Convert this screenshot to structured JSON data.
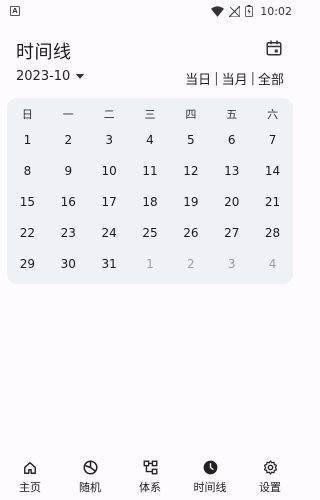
{
  "status_bar": {
    "notif_letter": "A",
    "time": "10:02"
  },
  "header": {
    "title": "时间线",
    "month": "2023-10",
    "filters": [
      "当日",
      "当月",
      "全部"
    ],
    "filter_separator": "|"
  },
  "calendar": {
    "weekdays": [
      "日",
      "一",
      "二",
      "三",
      "四",
      "五",
      "六"
    ],
    "weeks": [
      [
        {
          "d": "1",
          "muted": false
        },
        {
          "d": "2",
          "muted": false
        },
        {
          "d": "3",
          "muted": false
        },
        {
          "d": "4",
          "muted": false
        },
        {
          "d": "5",
          "muted": false
        },
        {
          "d": "6",
          "muted": false
        },
        {
          "d": "7",
          "muted": false
        }
      ],
      [
        {
          "d": "8",
          "muted": false
        },
        {
          "d": "9",
          "muted": false
        },
        {
          "d": "10",
          "muted": false
        },
        {
          "d": "11",
          "muted": false
        },
        {
          "d": "12",
          "muted": false
        },
        {
          "d": "13",
          "muted": false
        },
        {
          "d": "14",
          "muted": false
        }
      ],
      [
        {
          "d": "15",
          "muted": false
        },
        {
          "d": "16",
          "muted": false
        },
        {
          "d": "17",
          "muted": false
        },
        {
          "d": "18",
          "muted": false
        },
        {
          "d": "19",
          "muted": false
        },
        {
          "d": "20",
          "muted": false
        },
        {
          "d": "21",
          "muted": false
        }
      ],
      [
        {
          "d": "22",
          "muted": false
        },
        {
          "d": "23",
          "muted": false
        },
        {
          "d": "24",
          "muted": false
        },
        {
          "d": "25",
          "muted": false
        },
        {
          "d": "26",
          "muted": false
        },
        {
          "d": "27",
          "muted": false
        },
        {
          "d": "28",
          "muted": false
        }
      ],
      [
        {
          "d": "29",
          "muted": false
        },
        {
          "d": "30",
          "muted": false
        },
        {
          "d": "31",
          "muted": false
        },
        {
          "d": "1",
          "muted": true
        },
        {
          "d": "2",
          "muted": true
        },
        {
          "d": "3",
          "muted": true
        },
        {
          "d": "4",
          "muted": true
        }
      ]
    ]
  },
  "bottom_nav": {
    "items": [
      {
        "label": "主页",
        "icon": "home-icon"
      },
      {
        "label": "随机",
        "icon": "random-icon"
      },
      {
        "label": "体系",
        "icon": "hierarchy-icon"
      },
      {
        "label": "时间线",
        "icon": "clock-icon"
      },
      {
        "label": "设置",
        "icon": "gear-icon"
      }
    ]
  },
  "colors": {
    "background": "#fdfbff",
    "card": "#eef1f5",
    "muted_day": "#9aa0a8",
    "text": "#1b1b1f"
  }
}
